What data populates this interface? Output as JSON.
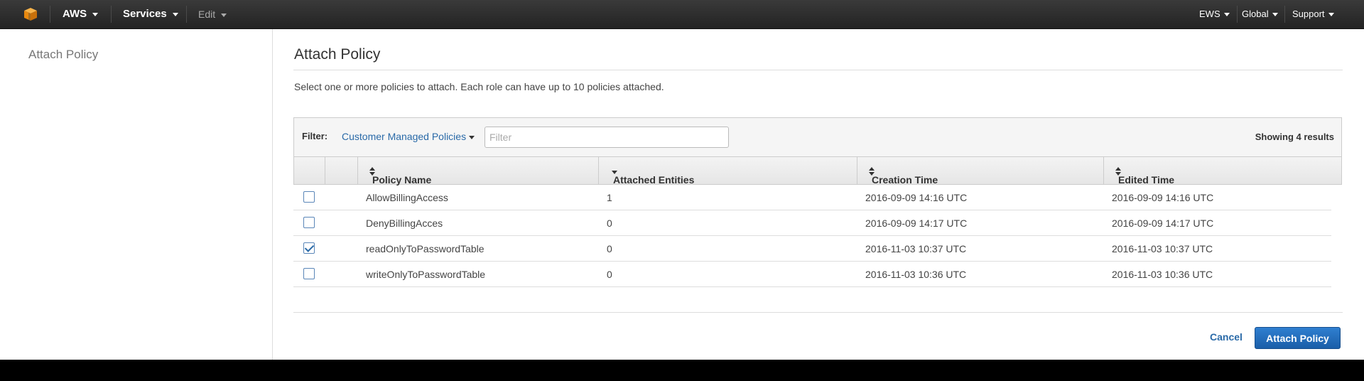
{
  "topbar": {
    "logo_icon": "aws-cube-icon",
    "aws_label": "AWS",
    "services_label": "Services",
    "edit_label": "Edit",
    "region_user_label": "EWS",
    "global_label": "Global",
    "support_label": "Support"
  },
  "leftnav": {
    "title": "Attach Policy"
  },
  "page": {
    "title": "Attach Policy",
    "description": "Select one or more policies to attach. Each role can have up to 10 policies attached."
  },
  "filter": {
    "label": "Filter:",
    "selected": "Customer Managed Policies",
    "placeholder": "Filter",
    "results": "Showing 4 results"
  },
  "table": {
    "headers": {
      "policy_name": "Policy Name",
      "attached_entities": "Attached Entities",
      "creation_time": "Creation Time",
      "edited_time": "Edited Time"
    },
    "rows": [
      {
        "checked": false,
        "name": "AllowBillingAccess",
        "entities": "1",
        "created": "2016-09-09 14:16 UTC",
        "edited": "2016-09-09 14:16 UTC"
      },
      {
        "checked": false,
        "name": "DenyBillingAcces",
        "entities": "0",
        "created": "2016-09-09 14:17 UTC",
        "edited": "2016-09-09 14:17 UTC"
      },
      {
        "checked": true,
        "name": "readOnlyToPasswordTable",
        "entities": "0",
        "created": "2016-11-03 10:37 UTC",
        "edited": "2016-11-03 10:37 UTC"
      },
      {
        "checked": false,
        "name": "writeOnlyToPasswordTable",
        "entities": "0",
        "created": "2016-11-03 10:36 UTC",
        "edited": "2016-11-03 10:36 UTC"
      }
    ]
  },
  "actions": {
    "cancel": "Cancel",
    "attach": "Attach Policy"
  },
  "colors": {
    "primary": "#1a5ea8",
    "link": "#2a6aa8",
    "topbar": "#2b2b2b",
    "logo": "#f29a1a"
  }
}
